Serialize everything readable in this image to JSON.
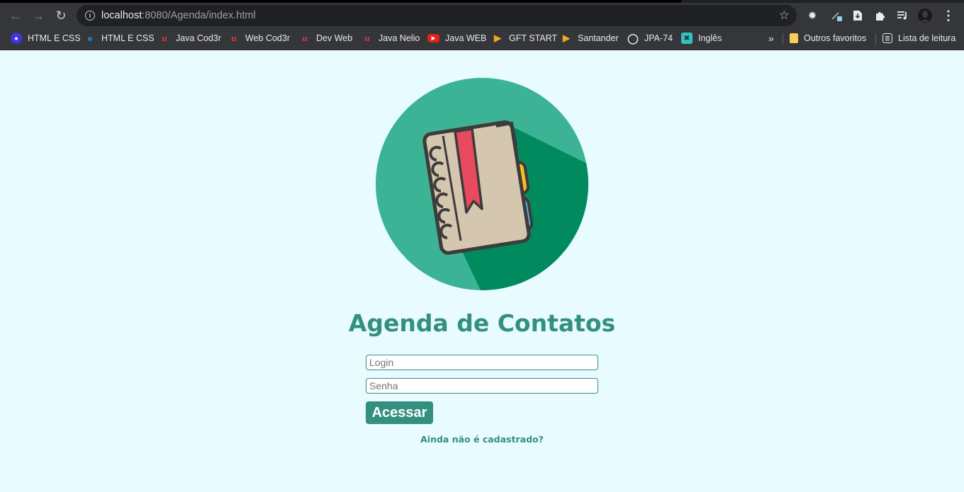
{
  "browser": {
    "url_host": "localhost",
    "url_rest": ":8080/Agenda/index.html",
    "bookmarks": [
      {
        "label": "HTML E CSS",
        "icon": "discord-like-icon"
      },
      {
        "label": "HTML E CSS",
        "icon": "people-icon"
      },
      {
        "label": "Java Cod3r",
        "icon": "udemy-icon"
      },
      {
        "label": "Web Cod3r",
        "icon": "udemy-icon"
      },
      {
        "label": "Dev Web",
        "icon": "udemy-icon"
      },
      {
        "label": "Java Nelio",
        "icon": "udemy-icon"
      },
      {
        "label": "Java WEB",
        "icon": "youtube-icon"
      },
      {
        "label": "GFT START",
        "icon": "dio-icon"
      },
      {
        "label": "Santander",
        "icon": "dio-icon"
      },
      {
        "label": "JPA-74",
        "icon": "globe-icon"
      },
      {
        "label": "Inglês",
        "icon": "cambly-icon"
      }
    ],
    "overflow_label": "»",
    "other_bookmarks": "Outros favoritos",
    "reading_list": "Lista de leitura"
  },
  "page": {
    "title": "Agenda de Contatos",
    "login_placeholder": "Login",
    "password_placeholder": "Senha",
    "submit_label": "Acessar",
    "register_link": "Ainda não é cadastrado?"
  },
  "colors": {
    "brand": "#33907f",
    "background": "#e8fbff",
    "logo_circle": "#3bb394",
    "logo_shadow": "#008a5e"
  }
}
